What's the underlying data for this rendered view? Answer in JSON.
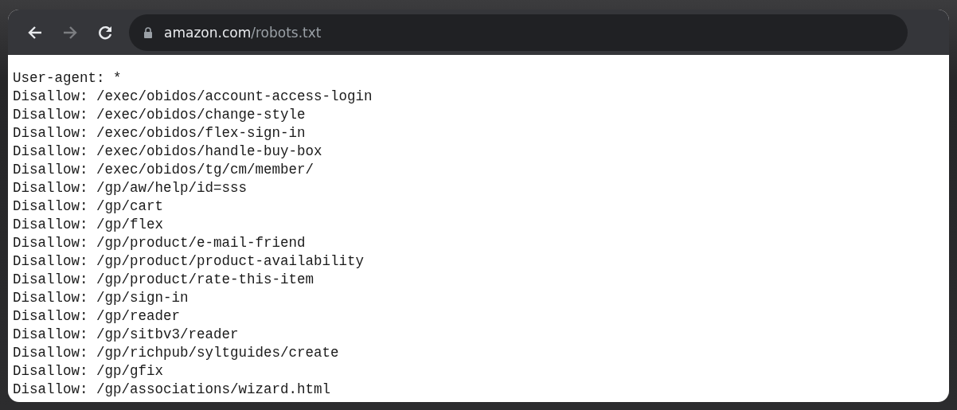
{
  "address_bar": {
    "host": "amazon.com",
    "path": "/robots.txt"
  },
  "lines": [
    "User-agent: *",
    "Disallow: /exec/obidos/account-access-login",
    "Disallow: /exec/obidos/change-style",
    "Disallow: /exec/obidos/flex-sign-in",
    "Disallow: /exec/obidos/handle-buy-box",
    "Disallow: /exec/obidos/tg/cm/member/",
    "Disallow: /gp/aw/help/id=sss",
    "Disallow: /gp/cart",
    "Disallow: /gp/flex",
    "Disallow: /gp/product/e-mail-friend",
    "Disallow: /gp/product/product-availability",
    "Disallow: /gp/product/rate-this-item",
    "Disallow: /gp/sign-in",
    "Disallow: /gp/reader",
    "Disallow: /gp/sitbv3/reader",
    "Disallow: /gp/richpub/syltguides/create",
    "Disallow: /gp/gfix",
    "Disallow: /gp/associations/wizard.html"
  ]
}
